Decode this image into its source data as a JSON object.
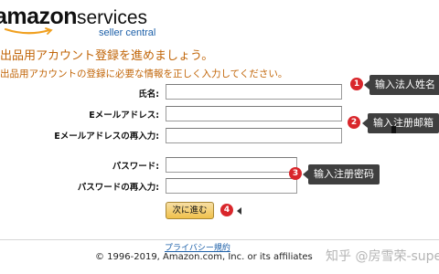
{
  "logo": {
    "brand": "amazon",
    "product": "services",
    "tagline": "seller central"
  },
  "heading": "出品用アカウント登録を進めましょう。",
  "subheading": "出品用アカウントの登録に必要な情報を正しく入力してください。",
  "form": {
    "name_label": "氏名:",
    "email_label": "Eメールアドレス:",
    "email_confirm_label": "Eメールアドレスの再入力:",
    "password_label": "パスワード:",
    "password_confirm_label": "パスワードの再入力:",
    "name_value": "",
    "email_value": "",
    "email_confirm_value": "",
    "password_value": "",
    "password_confirm_value": "",
    "submit_label": "次に進む"
  },
  "annotations": [
    {
      "number": "1",
      "text": "输入法人姓名"
    },
    {
      "number": "2",
      "text": "输入注册邮箱"
    },
    {
      "number": "3",
      "text": "输入注册密码"
    },
    {
      "number": "4",
      "text": ""
    }
  ],
  "footer": {
    "privacy_link": "プライバシー規約",
    "copyright": "© 1996-2019, Amazon.com, Inc. or its affiliates"
  },
  "watermark": "知乎 @房雪荣-supe",
  "colors": {
    "heading": "#c16508",
    "badge": "#d9262b",
    "callout_bg": "#3f3f3f",
    "link": "#1c5fa8"
  }
}
